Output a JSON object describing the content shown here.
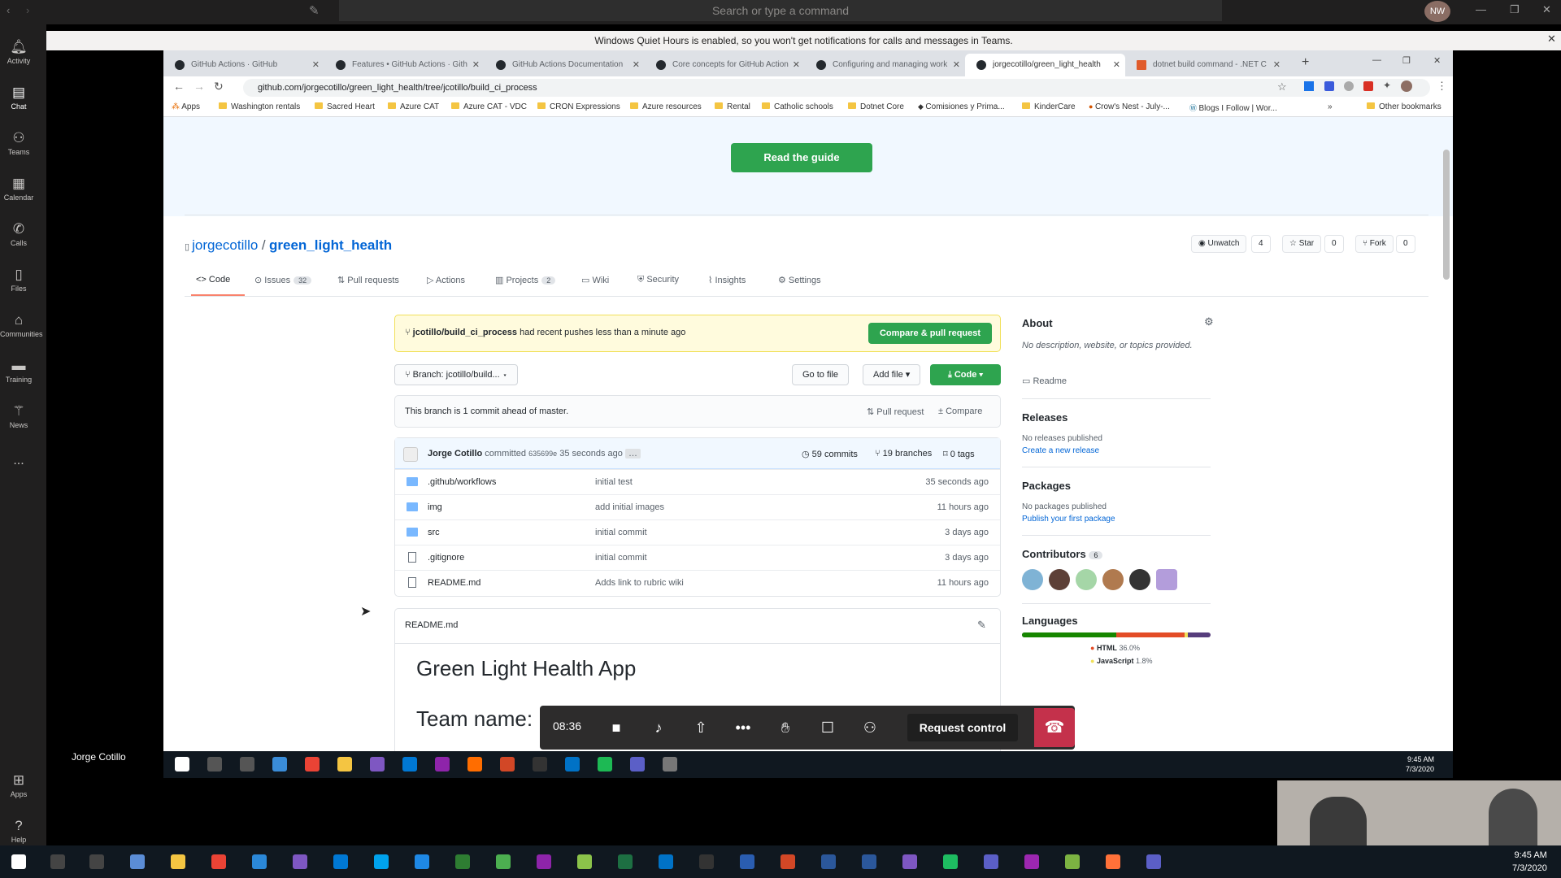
{
  "teams": {
    "search_placeholder": "Search or type a command",
    "avatar_initials": "NW",
    "rail": [
      {
        "label": "Activity",
        "icon": "bell-icon"
      },
      {
        "label": "Chat",
        "icon": "chat-icon"
      },
      {
        "label": "Teams",
        "icon": "teams-icon"
      },
      {
        "label": "Calendar",
        "icon": "calendar-icon"
      },
      {
        "label": "Calls",
        "icon": "phone-icon"
      },
      {
        "label": "Files",
        "icon": "file-icon"
      },
      {
        "label": "Communities",
        "icon": "communities-icon"
      },
      {
        "label": "Training",
        "icon": "training-icon"
      },
      {
        "label": "News",
        "icon": "news-icon"
      },
      {
        "label": "...",
        "icon": "more-icon"
      },
      {
        "label": "Apps",
        "icon": "apps-icon"
      },
      {
        "label": "Help",
        "icon": "help-icon"
      }
    ],
    "quiet_hours": "Windows Quiet Hours is enabled, so you won't get notifications for calls and messages in Teams.",
    "presenter": "Jorge Cotillo",
    "call": {
      "timer": "08:36",
      "request_control": "Request control"
    }
  },
  "browser": {
    "tabs": [
      "GitHub Actions · GitHub",
      "Features • GitHub Actions · Gith",
      "GitHub Actions Documentation",
      "Core concepts for GitHub Action",
      "Configuring and managing work",
      "jorgecotillo/green_light_health",
      "dotnet build command - .NET C"
    ],
    "url": "github.com/jorgecotillo/green_light_health/tree/jcotillo/build_ci_process",
    "bookmarks": [
      "Apps",
      "Washington rentals",
      "Sacred Heart",
      "Azure CAT",
      "Azure CAT - VDC",
      "CRON Expressions",
      "Azure resources",
      "Rental",
      "Catholic schools",
      "Dotnet Core",
      "Comisiones y Prima...",
      "KinderCare",
      "Crow's Nest - July-...",
      "Blogs I Follow | Wor...",
      "Other bookmarks"
    ]
  },
  "repo": {
    "read_guide": "Read the guide",
    "owner": "jorgecotillo",
    "sep": "/",
    "name": "green_light_health",
    "unwatch": "Unwatch",
    "watch_count": "4",
    "star": "Star",
    "star_count": "0",
    "fork": "Fork",
    "fork_count": "0",
    "tabs": [
      {
        "label": "Code",
        "count": ""
      },
      {
        "label": "Issues",
        "count": "32"
      },
      {
        "label": "Pull requests",
        "count": ""
      },
      {
        "label": "Actions",
        "count": ""
      },
      {
        "label": "Projects",
        "count": "2"
      },
      {
        "label": "Wiki",
        "count": ""
      },
      {
        "label": "Security",
        "count": ""
      },
      {
        "label": "Insights",
        "count": ""
      },
      {
        "label": "Settings",
        "count": ""
      }
    ],
    "push_branch": "jcotillo/build_ci_process",
    "push_text": "had recent pushes less than a minute ago",
    "compare_pr": "Compare & pull request",
    "branch": "Branch: jcotillo/build...",
    "go_to_file": "Go to file",
    "add_file": "Add file",
    "code": "Code",
    "ahead": "This branch is 1 commit ahead of master.",
    "pull_request": "Pull request",
    "compare": "Compare",
    "commit": {
      "author": "Jorge Cotillo",
      "verb": "committed",
      "sha": "635699e",
      "time": "35 seconds ago",
      "commits": "59 commits",
      "branches": "19 branches",
      "tags": "0 tags"
    },
    "files": [
      {
        "name": ".github/workflows",
        "msg": "initial test",
        "time": "35 seconds ago",
        "type": "dir"
      },
      {
        "name": "img",
        "msg": "add initial images",
        "time": "11 hours ago",
        "type": "dir"
      },
      {
        "name": "src",
        "msg": "initial commit",
        "time": "3 days ago",
        "type": "dir"
      },
      {
        "name": ".gitignore",
        "msg": "initial commit",
        "time": "3 days ago",
        "type": "file"
      },
      {
        "name": "README.md",
        "msg": "Adds link to rubric wiki",
        "time": "11 hours ago",
        "type": "file"
      }
    ],
    "readme_label": "README.md",
    "readme_title": "Green Light Health App",
    "readme_team": "Team name:",
    "about": "About",
    "about_desc": "No description, website, or topics provided.",
    "readme_link": "Readme",
    "releases": "Releases",
    "no_releases": "No releases published",
    "create_release": "Create a new release",
    "packages": "Packages",
    "no_packages": "No packages published",
    "publish_package": "Publish your first package",
    "contributors": "Contributors",
    "contributors_count": "6",
    "languages": "Languages",
    "lang": [
      {
        "name": "HTML",
        "pct": "36.0%",
        "color": "#e34c26"
      },
      {
        "name": "JavaScript",
        "pct": "1.8%",
        "color": "#f1e05a"
      }
    ]
  },
  "clock": {
    "inner_time": "9:45 AM",
    "inner_date": "7/3/2020",
    "time": "9:45 AM",
    "date": "7/3/2020"
  }
}
